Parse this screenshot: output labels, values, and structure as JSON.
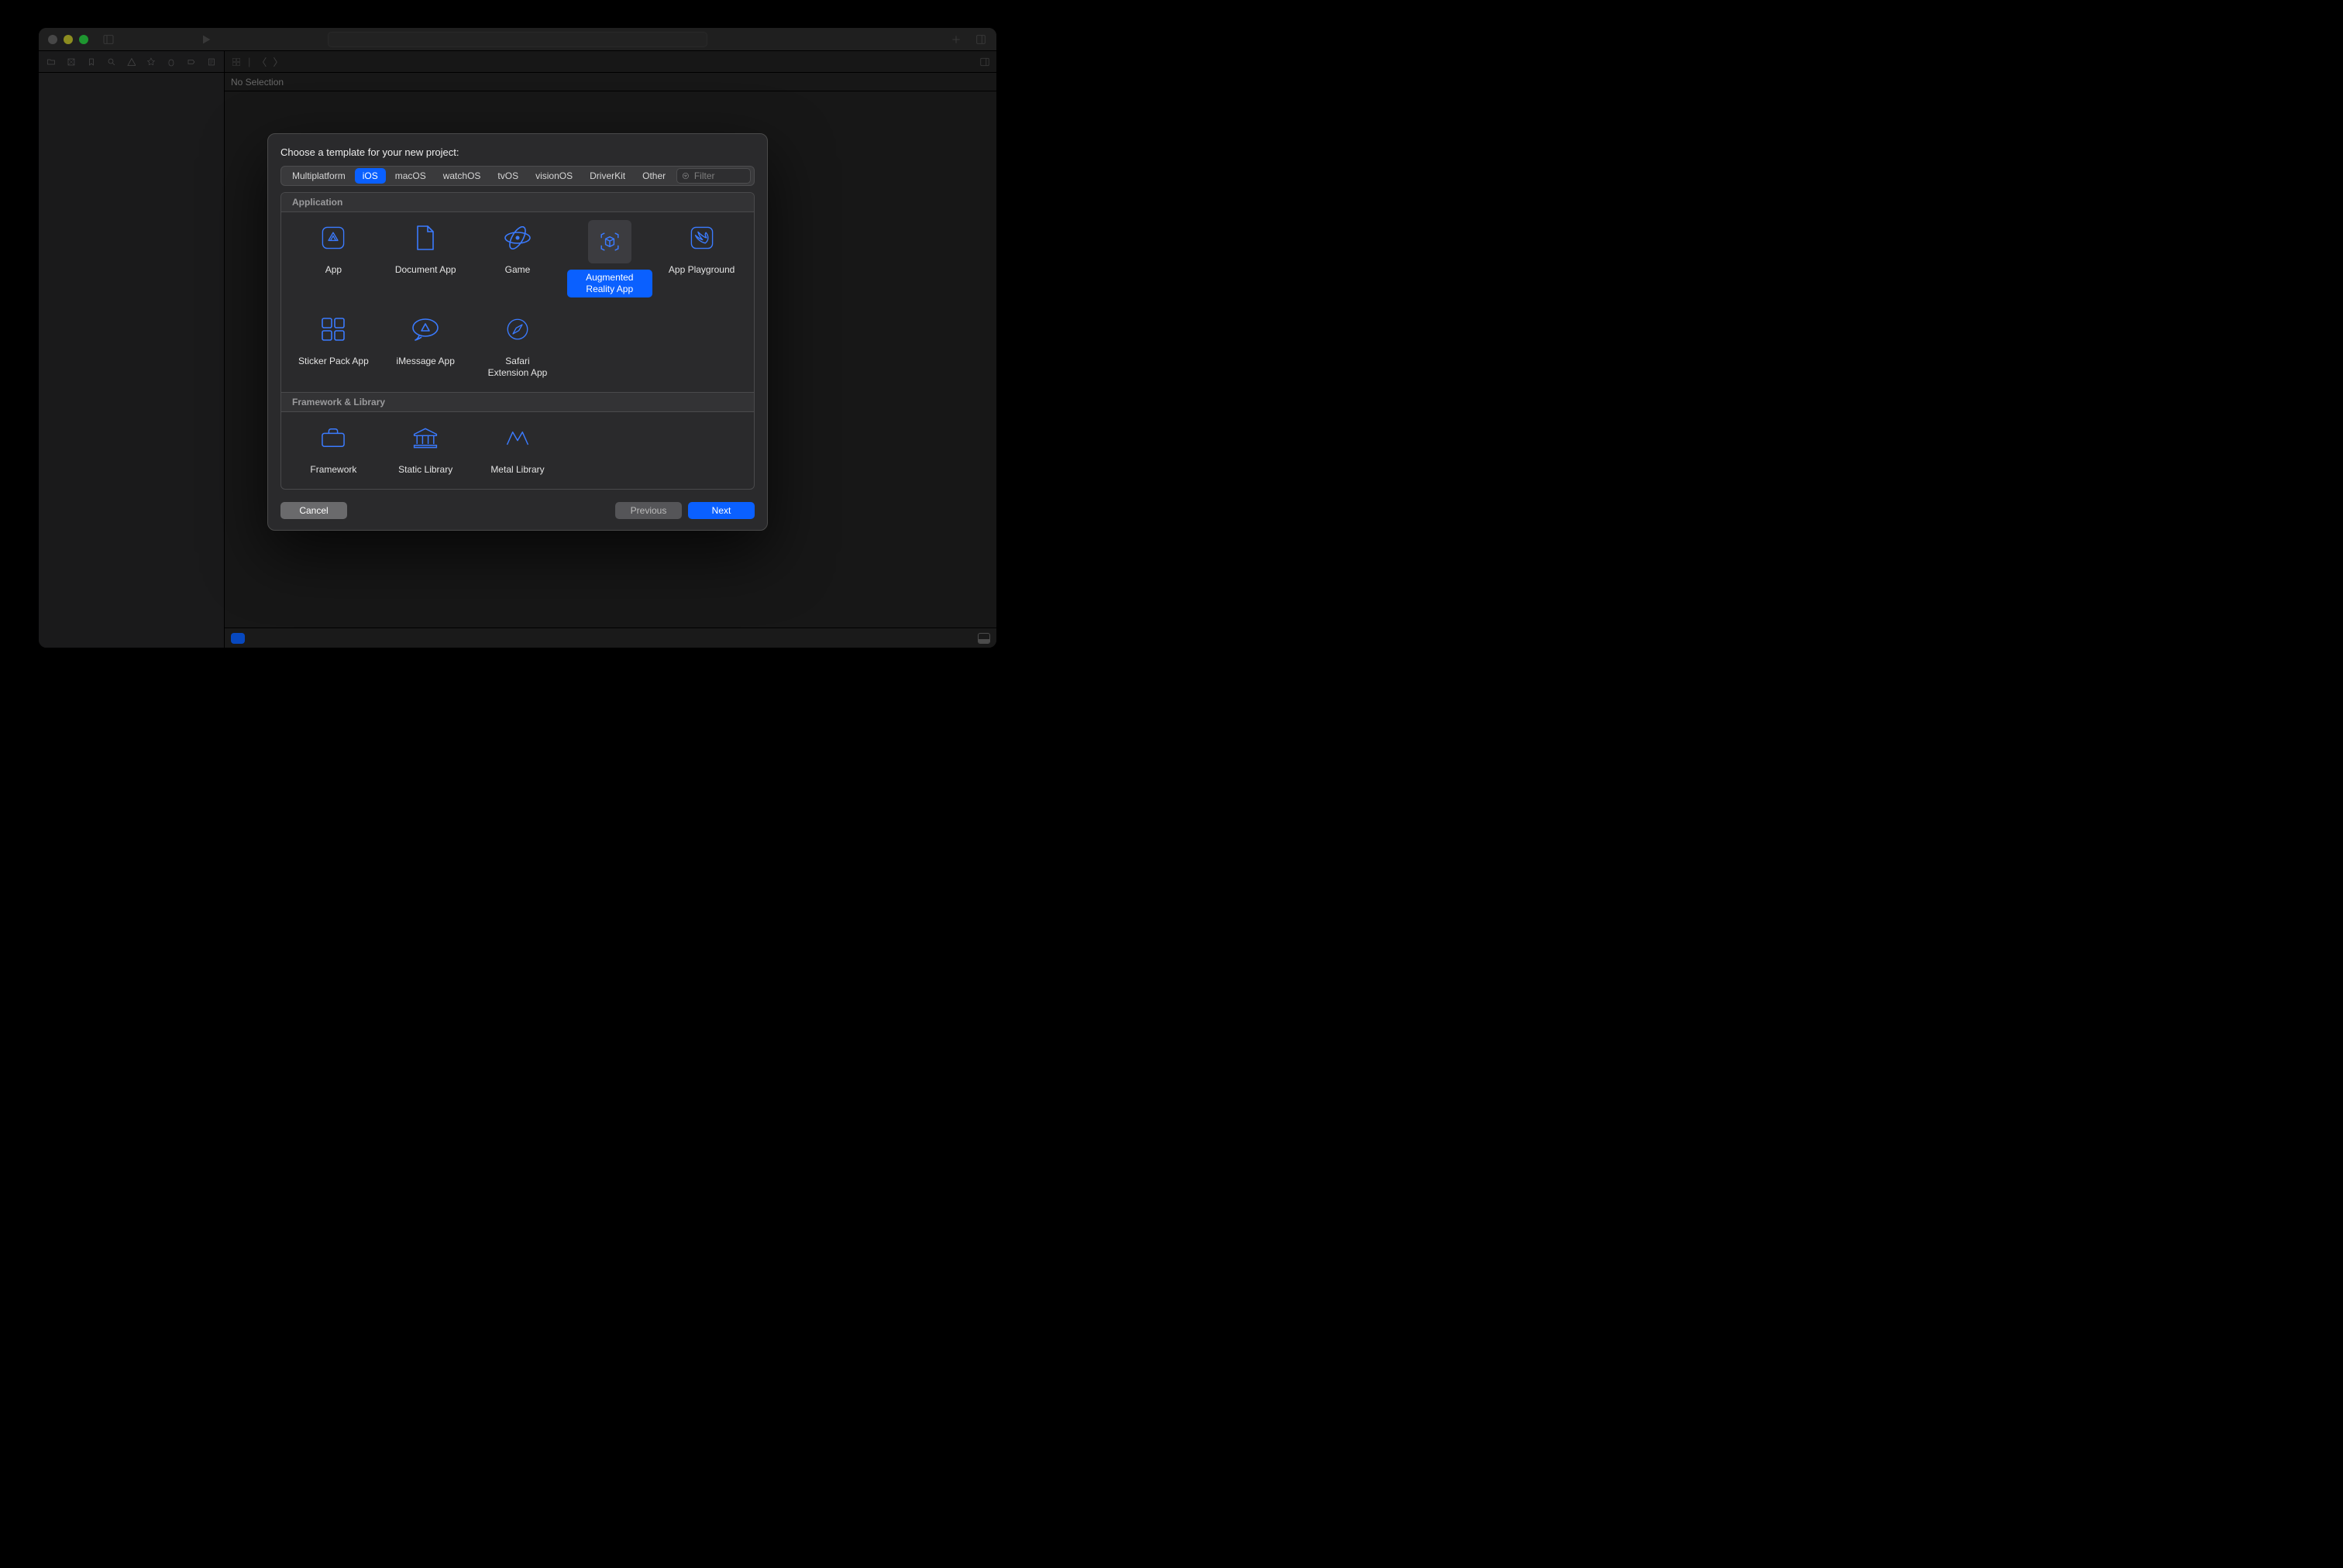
{
  "editor": {
    "no_selection": "No Selection"
  },
  "modal": {
    "title": "Choose a template for your new project:",
    "tabs": [
      "Multiplatform",
      "iOS",
      "macOS",
      "watchOS",
      "tvOS",
      "visionOS",
      "DriverKit",
      "Other"
    ],
    "active_tab": "iOS",
    "filter_placeholder": "Filter",
    "sections": {
      "application": {
        "header": "Application",
        "items": [
          {
            "id": "app",
            "label": "App"
          },
          {
            "id": "document-app",
            "label": "Document App"
          },
          {
            "id": "game",
            "label": "Game"
          },
          {
            "id": "augmented-reality-app",
            "label": "Augmented Reality App",
            "selected": true
          },
          {
            "id": "app-playground",
            "label": "App Playground"
          },
          {
            "id": "sticker-pack-app",
            "label": "Sticker Pack App"
          },
          {
            "id": "imessage-app",
            "label": "iMessage App"
          },
          {
            "id": "safari-extension-app",
            "label": "Safari Extension App"
          }
        ]
      },
      "framework": {
        "header": "Framework & Library",
        "items": [
          {
            "id": "framework",
            "label": "Framework"
          },
          {
            "id": "static-library",
            "label": "Static Library"
          },
          {
            "id": "metal-library",
            "label": "Metal Library"
          }
        ]
      }
    },
    "buttons": {
      "cancel": "Cancel",
      "previous": "Previous",
      "next": "Next"
    }
  },
  "colors": {
    "accent": "#0a60ff",
    "icon_blue": "#3b7bff"
  }
}
